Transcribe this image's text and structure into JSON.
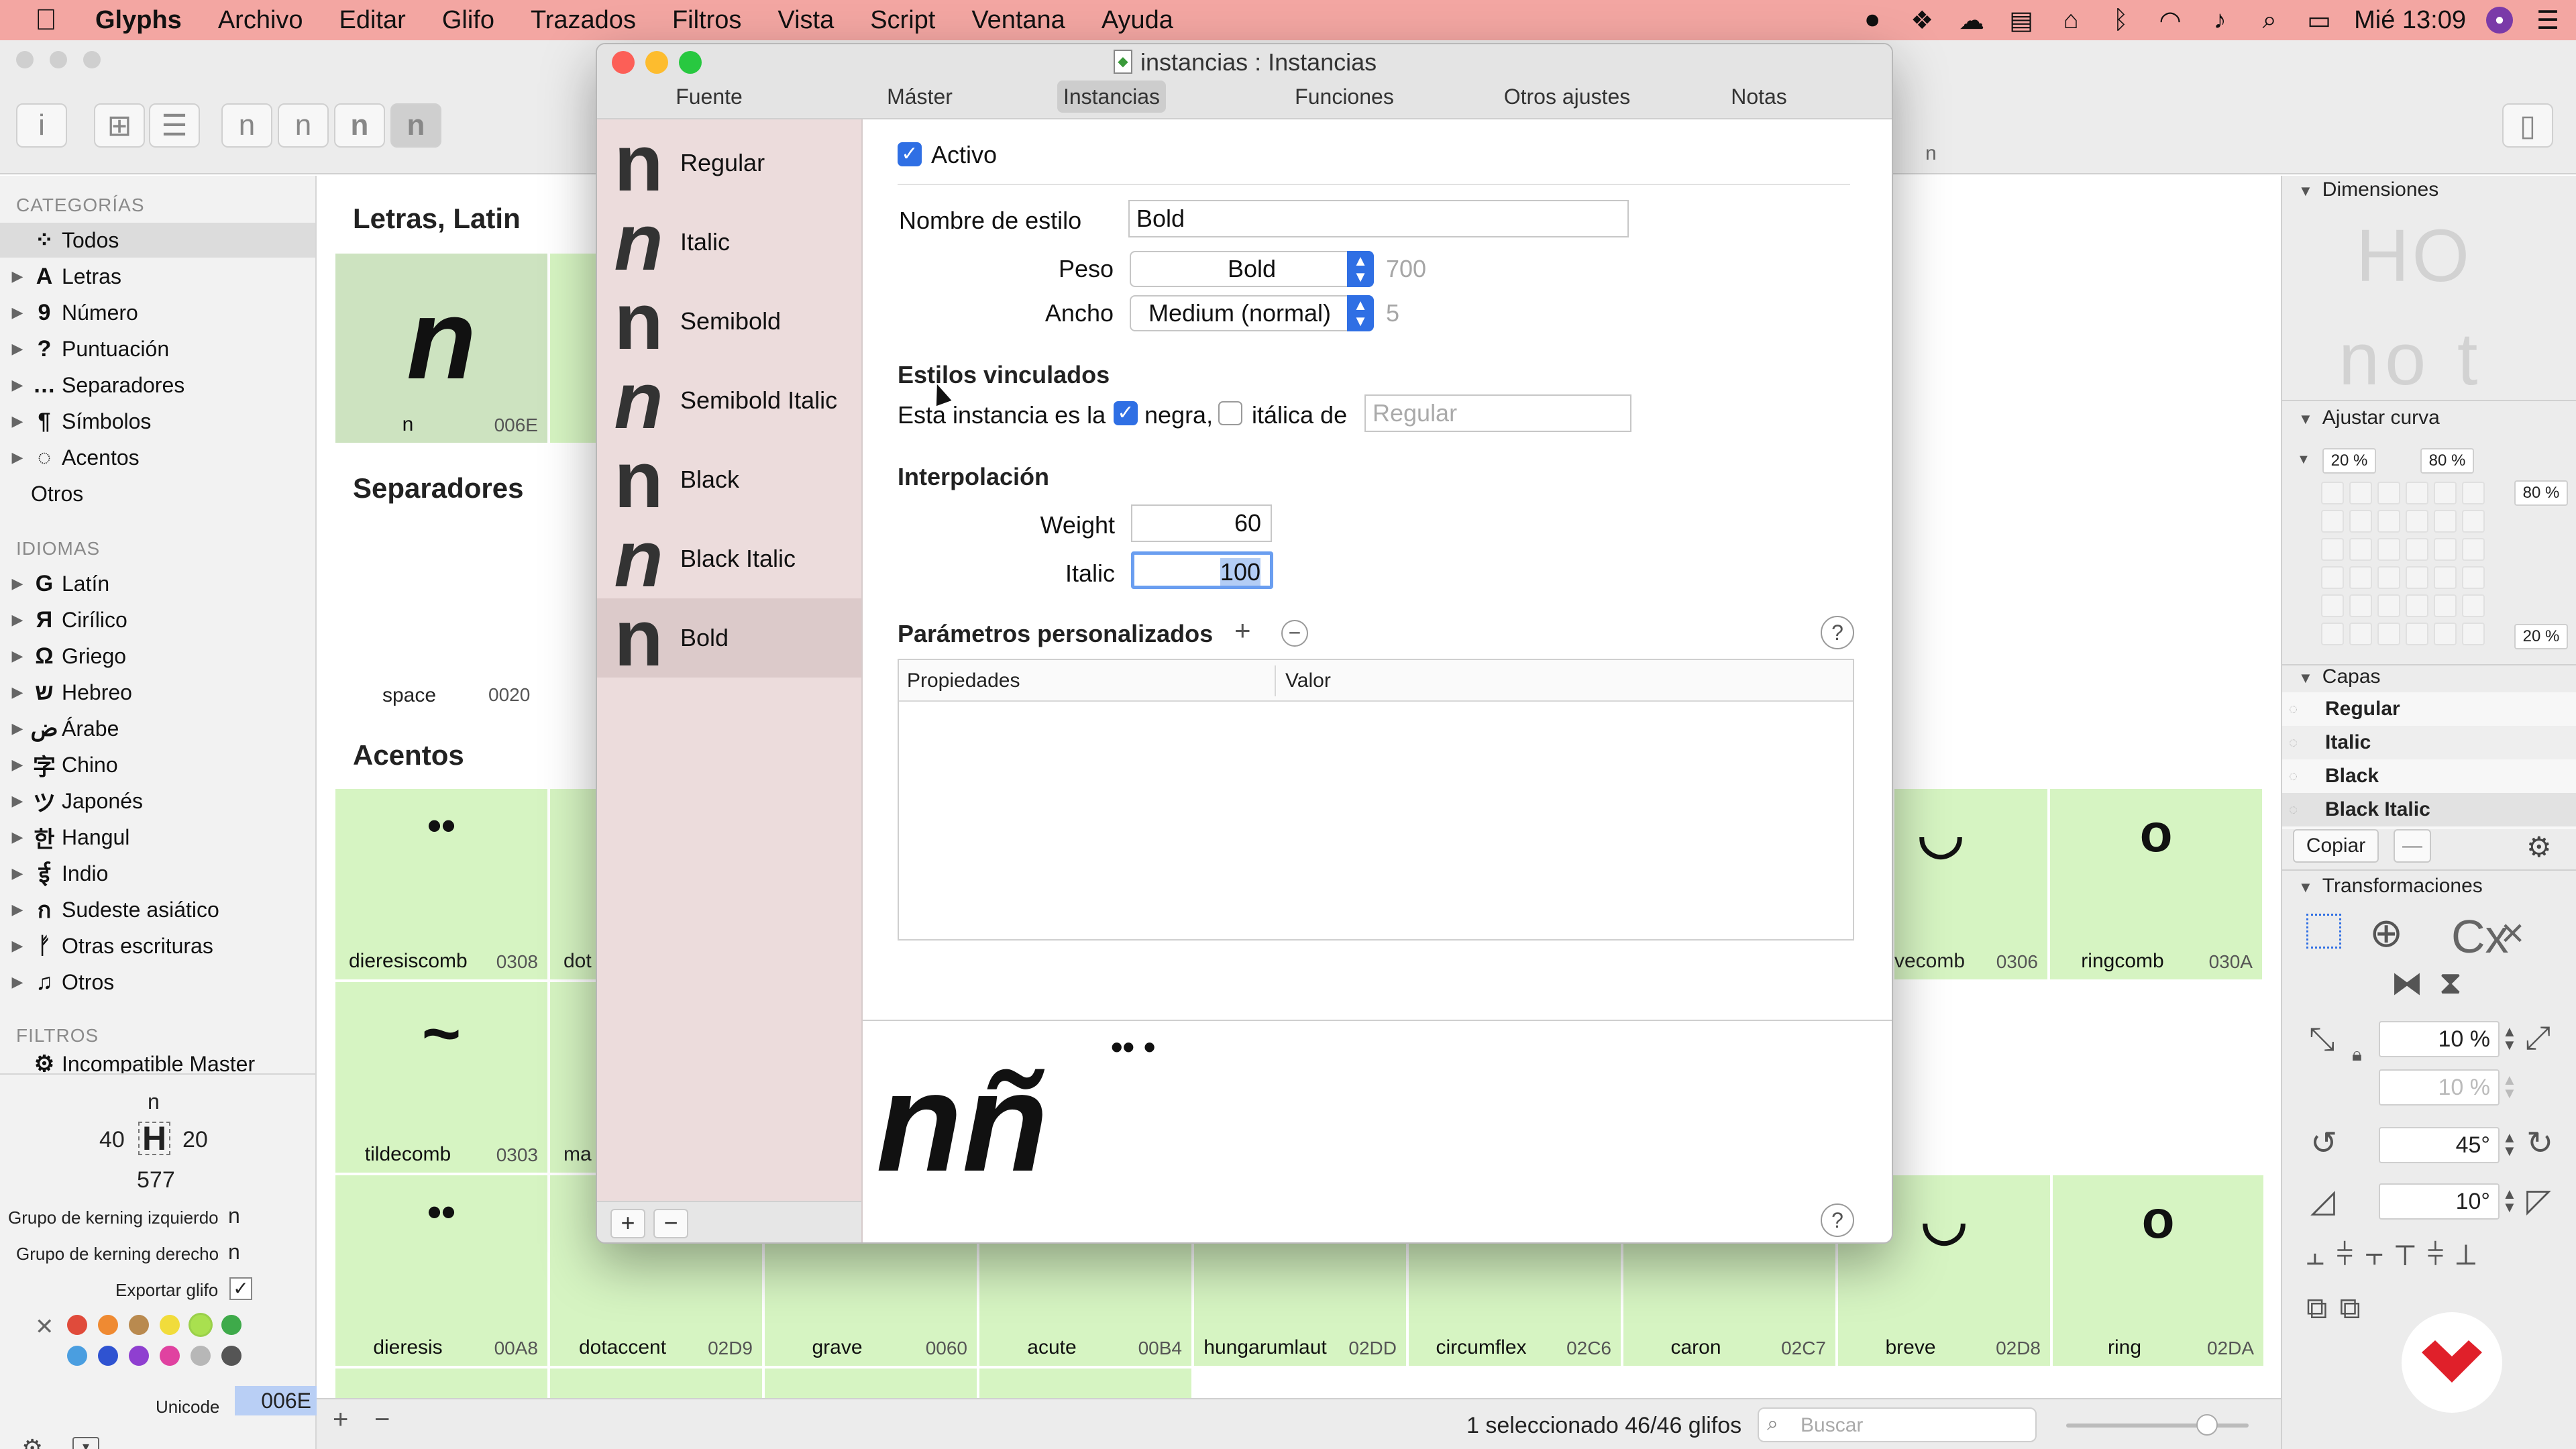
{
  "menubar": {
    "app": "Glyphs",
    "items": [
      "Archivo",
      "Editar",
      "Glifo",
      "Trazados",
      "Filtros",
      "Vista",
      "Script",
      "Ventana",
      "Ayuda"
    ],
    "clock": "Mié 13:09"
  },
  "sidebar": {
    "categories_head": "CATEGORÍAS",
    "categories": [
      {
        "glyph": "⁘",
        "label": "Todos"
      },
      {
        "glyph": "A",
        "label": "Letras"
      },
      {
        "glyph": "9",
        "label": "Número"
      },
      {
        "glyph": "?",
        "label": "Puntuación"
      },
      {
        "glyph": "…",
        "label": "Separadores"
      },
      {
        "glyph": "¶",
        "label": "Símbolos"
      },
      {
        "glyph": "◌",
        "label": "Acentos"
      },
      {
        "glyph": "",
        "label": "Otros"
      }
    ],
    "languages_head": "IDIOMAS",
    "languages": [
      {
        "glyph": "G",
        "label": "Latín"
      },
      {
        "glyph": "Я",
        "label": "Cirílico"
      },
      {
        "glyph": "Ω",
        "label": "Griego"
      },
      {
        "glyph": "ש",
        "label": "Hebreo"
      },
      {
        "glyph": "ض",
        "label": "Árabe"
      },
      {
        "glyph": "字",
        "label": "Chino"
      },
      {
        "glyph": "ツ",
        "label": "Japonés"
      },
      {
        "glyph": "한",
        "label": "Hangul"
      },
      {
        "glyph": "ई",
        "label": "Indio"
      },
      {
        "glyph": "ก",
        "label": "Sudeste asiático"
      },
      {
        "glyph": "ᚠ",
        "label": "Otras escrituras"
      },
      {
        "glyph": "♫",
        "label": "Otros"
      }
    ],
    "filters_head": "FILTROS",
    "filter_item": "Incompatible Master"
  },
  "info": {
    "glyph": "n",
    "lsb": "40",
    "rsb": "20",
    "width": "577",
    "left_kern_label": "Grupo de kerning izquierdo",
    "left_kern_value": "n",
    "right_kern_label": "Grupo de kerning derecho",
    "right_kern_value": "n",
    "export_label": "Exportar glifo",
    "unicode_label": "Unicode",
    "unicode_value": "006E",
    "colors": [
      "#e04b3b",
      "#ef8a32",
      "#b98a4f",
      "#f1dc3b",
      "#a9e04f",
      "#3eaa4a",
      "#4a9ee0",
      "#2f53d1",
      "#8f3fd0",
      "#e042a0",
      "#b7b7b7",
      "#555555"
    ]
  },
  "grid": {
    "section_letters": "Letras, Latin",
    "section_separators": "Separadores",
    "section_accents": "Acentos",
    "n_cell": {
      "glyph": "n",
      "name": "n",
      "code": "006E"
    },
    "space_cell": {
      "name": "space",
      "code": "0020"
    },
    "row1": [
      {
        "glyph": "••",
        "name": "dieresiscomb",
        "code": "0308"
      },
      {
        "glyph": "",
        "name": "dot",
        "code": ""
      },
      {
        "glyph": "◡",
        "name": "vecomb",
        "code": "0306"
      },
      {
        "glyph": "o",
        "name": "ringcomb",
        "code": "030A"
      }
    ],
    "row2": [
      {
        "glyph": "~",
        "name": "tildecomb",
        "code": "0303"
      },
      {
        "glyph": "",
        "name": "ma",
        "code": ""
      }
    ],
    "row3": [
      {
        "glyph": "••",
        "name": "dieresis",
        "code": "00A8"
      },
      {
        "glyph": "",
        "name": "dotaccent",
        "code": "02D9"
      },
      {
        "glyph": "",
        "name": "grave",
        "code": "0060"
      },
      {
        "glyph": "",
        "name": "acute",
        "code": "00B4"
      },
      {
        "glyph": "",
        "name": "hungarumlaut",
        "code": "02DD"
      },
      {
        "glyph": "",
        "name": "circumflex",
        "code": "02C6"
      },
      {
        "glyph": "",
        "name": "caron",
        "code": "02C7"
      },
      {
        "glyph": "◡",
        "name": "breve",
        "code": "02D8"
      },
      {
        "glyph": "o",
        "name": "ring",
        "code": "02DA"
      }
    ],
    "header_char": "n"
  },
  "status": {
    "count": "1 seleccionado 46/46 glifos",
    "search_placeholder": "Buscar"
  },
  "rpanel": {
    "dimensions": "Dimensiones",
    "dim_preview_top": "HO",
    "dim_preview_bottom": "no t",
    "curve": "Ajustar curva",
    "curve_top_left": "20 %",
    "curve_top_right": "80 %",
    "curve_right_top": "80 %",
    "curve_right_bottom": "20 %",
    "layers": "Capas",
    "layer_items": [
      "Regular",
      "Italic",
      "Black",
      "Black Italic"
    ],
    "copy_btn": "Copiar",
    "transforms": "Transformaciones",
    "cx_label": "Cx",
    "scale_x": "10 %",
    "scale_y": "10 %",
    "rotate": "45°",
    "slant": "10°"
  },
  "dialog": {
    "title": "instancias : Instancias",
    "tabs": [
      "Fuente",
      "Máster",
      "Instancias",
      "Funciones",
      "Otros ajustes",
      "Notas"
    ],
    "instances": [
      {
        "label": "Regular",
        "italic": false
      },
      {
        "label": "Italic",
        "italic": true
      },
      {
        "label": "Semibold",
        "italic": false
      },
      {
        "label": "Semibold Italic",
        "italic": true
      },
      {
        "label": "Black",
        "italic": false
      },
      {
        "label": "Black Italic",
        "italic": true
      },
      {
        "label": "Bold",
        "italic": false
      }
    ],
    "instance_glyph": "n",
    "active_label": "Activo",
    "style_name_label": "Nombre de estilo",
    "style_name_value": "Bold",
    "weight_label": "Peso",
    "weight_value": "Bold",
    "weight_num": "700",
    "width_label": "Ancho",
    "width_value": "Medium (normal)",
    "width_num": "5",
    "linked_head": "Estilos vinculados",
    "linked_prefix": "Esta instancia es la",
    "linked_bold": "negra,",
    "linked_italic": "itálica de",
    "linked_placeholder": "Regular",
    "interp_head": "Interpolación",
    "interp_weight_label": "Weight",
    "interp_weight_value": "60",
    "interp_italic_label": "Italic",
    "interp_italic_value": "100",
    "custom_head": "Parámetros personalizados",
    "col_props": "Propiedades",
    "col_value": "Valor",
    "preview_text": "nñ",
    "preview_marks": "•• •",
    "help": "?"
  }
}
